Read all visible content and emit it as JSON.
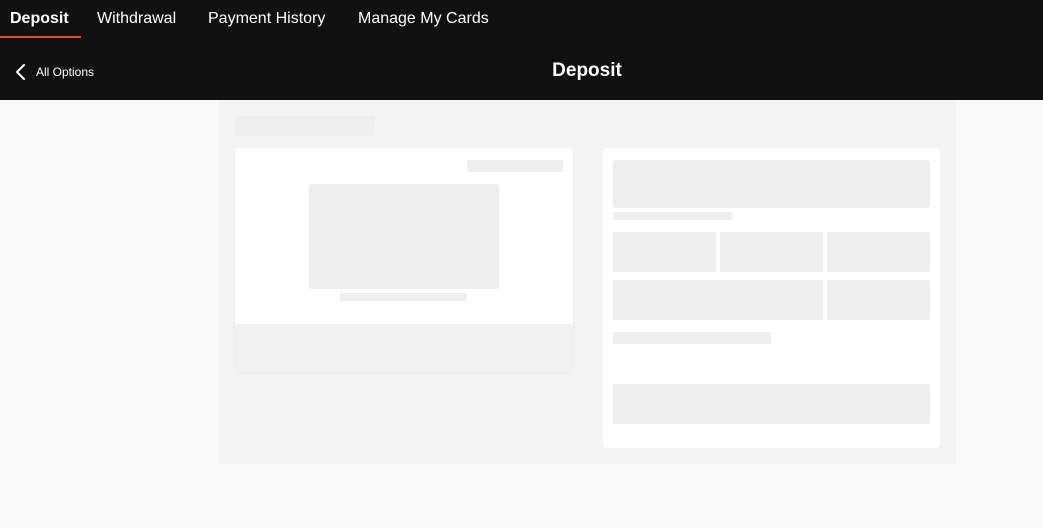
{
  "tabs": [
    {
      "label": "Deposit",
      "active": true
    },
    {
      "label": "Withdrawal",
      "active": false
    },
    {
      "label": "Payment History",
      "active": false
    },
    {
      "label": "Manage My Cards",
      "active": false
    }
  ],
  "header": {
    "back_label": "All Options",
    "back_icon": "chevron-left-icon",
    "title": "Deposit"
  },
  "colors": {
    "topbar_bg": "#111111",
    "active_tab_underline": "#e8501e",
    "page_bg": "#f9f9f9",
    "content_bg": "#f3f3f3",
    "skeleton": "#eeeeee"
  },
  "state": "loading"
}
